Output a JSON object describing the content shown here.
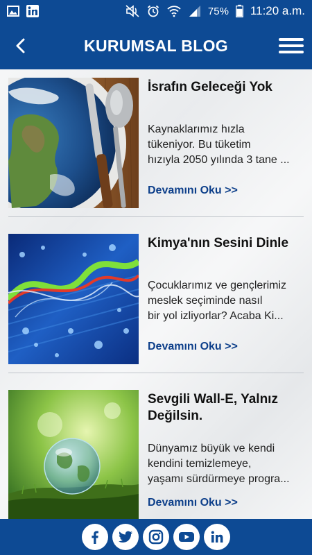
{
  "status_bar": {
    "battery": "75%",
    "time": "11:20 a.m.",
    "icons": [
      "gallery-icon",
      "linkedin-icon",
      "mute-icon",
      "alarm-icon",
      "wifi-icon",
      "signal-icon",
      "battery-icon"
    ]
  },
  "app_bar": {
    "title": "KURUMSAL BLOG",
    "back_icon": "chevron-left-icon",
    "menu_icon": "hamburger-menu-icon"
  },
  "posts": [
    {
      "title": "İsrafın Geleceği Yok",
      "excerpt_lines": [
        "Kaynaklarımız hızla",
        "tükeniyor. Bu tüketim",
        "hızıyla 2050 yılında 3 tane ..."
      ],
      "more": "Devamını Oku >>",
      "image": "earth-plate-cutlery"
    },
    {
      "title": "Kimya'nın Sesini Dinle",
      "excerpt_lines": [
        "Çocuklarımız ve gençlerimiz",
        "meslek seçiminde nasıl",
        "bir yol izliyorlar? Acaba Ki..."
      ],
      "more": "Devamını Oku >>",
      "image": "abstract-chemistry-waves"
    },
    {
      "title_lines": [
        "Sevgili Wall-E, Yalnız",
        "Değilsin."
      ],
      "excerpt_lines": [
        "Dünyamız büyük ve kendi",
        "kendini temizlemeye,",
        "yaşamı sürdürmeye progra..."
      ],
      "more": "Devamını Oku >>",
      "image": "glass-globe-moss"
    }
  ],
  "footer": {
    "social": [
      "facebook-icon",
      "twitter-icon",
      "instagram-icon",
      "youtube-icon",
      "linkedin-icon"
    ]
  },
  "colors": {
    "primary": "#0d4a94",
    "link": "#0d3f8a",
    "background": "#eaecee"
  }
}
